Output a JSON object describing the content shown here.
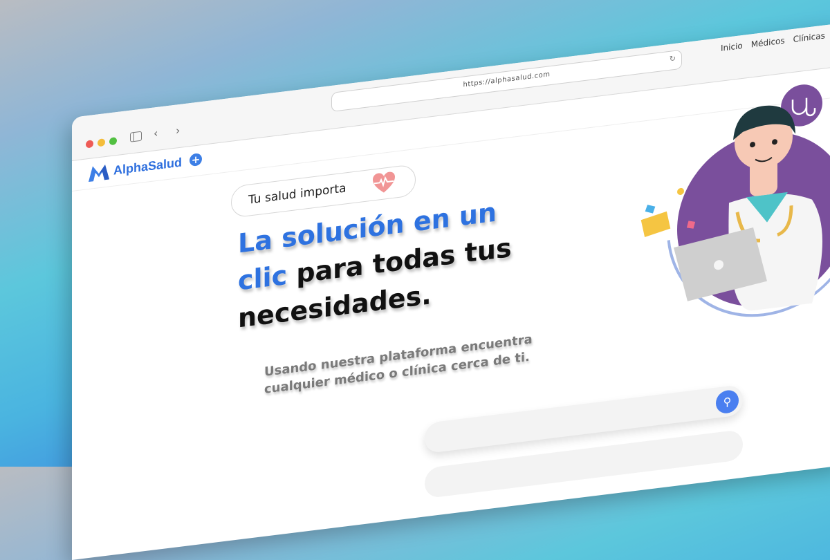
{
  "browser": {
    "url": "https://alphasalud.com",
    "nav": [
      "Inicio",
      "Médicos",
      "Clínicas"
    ]
  },
  "site": {
    "logo_text": "AlphaSalud",
    "tagline": "Tu salud importa",
    "headline_blue_1": "La solución en un",
    "headline_blue_2": "clic",
    "headline_black_2": " para todas tus",
    "headline_black_3": "necesidades.",
    "subtext_1": "Usando nuestra plataforma encuentra",
    "subtext_2": "cualquier médico o clínica cerca de ti."
  },
  "colors": {
    "brand_blue": "#2e72e0",
    "accent_purple": "#7a4f9c",
    "search_blue": "#4a7ff0"
  },
  "icons": [
    "sidebar-icon",
    "back-arrow-icon",
    "forward-arrow-icon",
    "reload-icon",
    "heart-icon",
    "search-icon",
    "stethoscope-icon",
    "plus-icon"
  ]
}
